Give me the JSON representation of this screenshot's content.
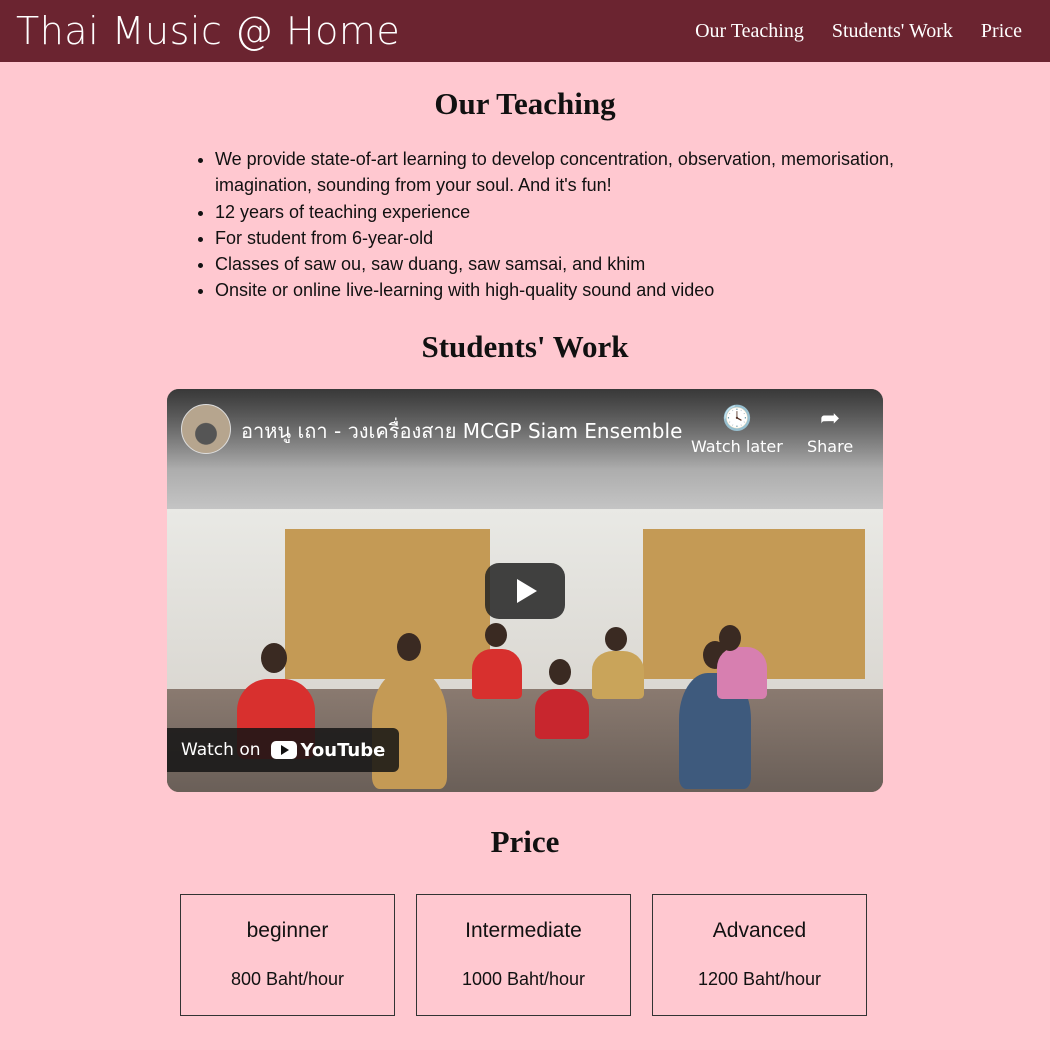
{
  "header": {
    "brand": "Thai Music @ Home",
    "nav": [
      "Our Teaching",
      "Students' Work",
      "Price"
    ]
  },
  "teaching": {
    "title": "Our Teaching",
    "items": [
      "We provide state-of-art learning to develop concentration, observation, memorisation, imagination, sounding from your soul. And it's fun!",
      "12 years of teaching experience",
      "For student from 6-year-old",
      "Classes of saw ou, saw duang, saw samsai, and khim",
      "Onsite or online live-learning with high-quality sound and video"
    ]
  },
  "students": {
    "title": "Students' Work",
    "video": {
      "title": "อาหนู เถา - วงเครื่องสาย MCGP Siam Ensemble",
      "watch_later": "Watch later",
      "share": "Share",
      "watch_on": "Watch on",
      "youtube": "YouTube"
    }
  },
  "price": {
    "title": "Price",
    "cards": [
      {
        "level": "beginner",
        "rate": "800 Baht/hour"
      },
      {
        "level": "Intermediate",
        "rate": "1000 Baht/hour"
      },
      {
        "level": "Advanced",
        "rate": "1200 Baht/hour"
      }
    ]
  }
}
